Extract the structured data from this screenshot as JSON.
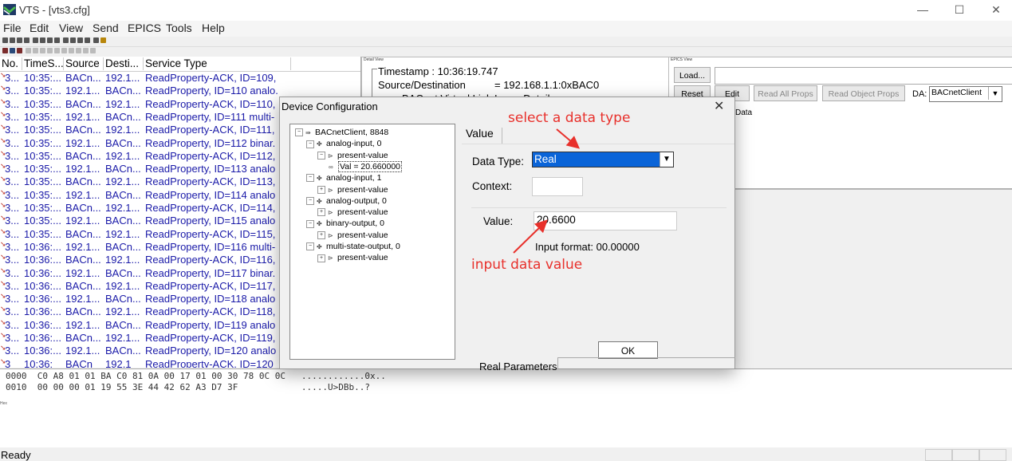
{
  "window": {
    "title": "VTS - [vts3.cfg]",
    "controls": [
      "—",
      "☐",
      "✕"
    ]
  },
  "menu": [
    "File",
    "Edit",
    "View",
    "Send",
    "EPICS",
    "Tools",
    "Help"
  ],
  "list": {
    "headers": [
      "No.",
      "TimeS...",
      "Source",
      "Desti...",
      "Service Type"
    ],
    "rows": [
      {
        "no": "3...",
        "time": "10:35:...",
        "src": "BACn...",
        "dst": "192.1...",
        "svc": "ReadProperty-ACK, ID=109, ..."
      },
      {
        "no": "3...",
        "time": "10:35:...",
        "src": "192.1...",
        "dst": "BACn...",
        "svc": "ReadProperty, ID=110 analo..."
      },
      {
        "no": "3...",
        "time": "10:35:...",
        "src": "BACn...",
        "dst": "192.1...",
        "svc": "ReadProperty-ACK, ID=110,"
      },
      {
        "no": "3...",
        "time": "10:35:...",
        "src": "192.1...",
        "dst": "BACn...",
        "svc": "ReadProperty, ID=111 multi-"
      },
      {
        "no": "3...",
        "time": "10:35:...",
        "src": "BACn...",
        "dst": "192.1...",
        "svc": "ReadProperty-ACK, ID=111,"
      },
      {
        "no": "3...",
        "time": "10:35:...",
        "src": "192.1...",
        "dst": "BACn...",
        "svc": "ReadProperty, ID=112 binar."
      },
      {
        "no": "3...",
        "time": "10:35:...",
        "src": "BACn...",
        "dst": "192.1...",
        "svc": "ReadProperty-ACK, ID=112,"
      },
      {
        "no": "3...",
        "time": "10:35:...",
        "src": "192.1...",
        "dst": "BACn...",
        "svc": "ReadProperty, ID=113 analo"
      },
      {
        "no": "3...",
        "time": "10:35:...",
        "src": "BACn...",
        "dst": "192.1...",
        "svc": "ReadProperty-ACK, ID=113,"
      },
      {
        "no": "3...",
        "time": "10:35:...",
        "src": "192.1...",
        "dst": "BACn...",
        "svc": "ReadProperty, ID=114 analo"
      },
      {
        "no": "3...",
        "time": "10:35:...",
        "src": "BACn...",
        "dst": "192.1...",
        "svc": "ReadProperty-ACK, ID=114,"
      },
      {
        "no": "3...",
        "time": "10:35:...",
        "src": "192.1...",
        "dst": "BACn...",
        "svc": "ReadProperty, ID=115 analo"
      },
      {
        "no": "3...",
        "time": "10:35:...",
        "src": "BACn...",
        "dst": "192.1...",
        "svc": "ReadProperty-ACK, ID=115,"
      },
      {
        "no": "3...",
        "time": "10:36:...",
        "src": "192.1...",
        "dst": "BACn...",
        "svc": "ReadProperty, ID=116 multi-"
      },
      {
        "no": "3...",
        "time": "10:36:...",
        "src": "BACn...",
        "dst": "192.1...",
        "svc": "ReadProperty-ACK, ID=116,"
      },
      {
        "no": "3...",
        "time": "10:36:...",
        "src": "192.1...",
        "dst": "BACn...",
        "svc": "ReadProperty, ID=117 binar."
      },
      {
        "no": "3...",
        "time": "10:36:...",
        "src": "BACn...",
        "dst": "192.1...",
        "svc": "ReadProperty-ACK, ID=117,"
      },
      {
        "no": "3...",
        "time": "10:36:...",
        "src": "192.1...",
        "dst": "BACn...",
        "svc": "ReadProperty, ID=118 analo"
      },
      {
        "no": "3...",
        "time": "10:36:...",
        "src": "BACn...",
        "dst": "192.1...",
        "svc": "ReadProperty-ACK, ID=118,"
      },
      {
        "no": "3...",
        "time": "10:36:...",
        "src": "192.1...",
        "dst": "BACn...",
        "svc": "ReadProperty, ID=119 analo"
      },
      {
        "no": "3...",
        "time": "10:36:...",
        "src": "BACn...",
        "dst": "192.1...",
        "svc": "ReadProperty-ACK, ID=119,"
      },
      {
        "no": "3...",
        "time": "10:36:...",
        "src": "192.1...",
        "dst": "BACn...",
        "svc": "ReadProperty, ID=120 analo"
      },
      {
        "no": "3",
        "time": "10:36:",
        "src": "BACn",
        "dst": "192.1",
        "svc": "ReadProperty-ACK, ID=120"
      }
    ]
  },
  "detail": {
    "caption": "Detail View",
    "timestamp": "Timestamp : 10:36:19.747",
    "srcdst_label": "Source/Destination",
    "srcdst_value": "= 192.168.1.1:0xBAC0",
    "bvll": "BACnet Virtual Link Layer Detail"
  },
  "epics": {
    "caption": "EPICS View",
    "load": "Load...",
    "reset": "Reset",
    "edit": "Edit",
    "read_all": "Read All Props",
    "read_obj": "Read Object Props",
    "da_label": "DA:",
    "da_value": "BACnetClient",
    "data_col": "Data"
  },
  "hex": {
    "lines": [
      "0000  C0 A8 01 01 BA C0 81 0A 00 17 01 00 30 78 0C 0C   ............0x..",
      "0010  00 00 00 01 19 55 3E 44 42 62 A3 D7 3F            .....U>DBb..?"
    ],
    "caption": "Hex"
  },
  "status": "Ready",
  "dialog": {
    "title": "Device Configuration",
    "tree": [
      {
        "label": "BACnetClient, 8848",
        "level": 0,
        "icon": "device-icon",
        "expander": "−"
      },
      {
        "label": "analog-input, 0",
        "level": 1,
        "icon": "object-icon",
        "expander": "−"
      },
      {
        "label": "present-value",
        "level": 2,
        "icon": "property-icon",
        "expander": "−"
      },
      {
        "label": "Val = 20.660000",
        "level": 3,
        "icon": "value-icon",
        "expander": "",
        "selected": true
      },
      {
        "label": "analog-input, 1",
        "level": 1,
        "icon": "object-icon",
        "expander": "−"
      },
      {
        "label": "present-value",
        "level": 2,
        "icon": "property-icon",
        "expander": "+"
      },
      {
        "label": "analog-output, 0",
        "level": 1,
        "icon": "object-icon",
        "expander": "−"
      },
      {
        "label": "present-value",
        "level": 2,
        "icon": "property-icon",
        "expander": "+"
      },
      {
        "label": "binary-output, 0",
        "level": 1,
        "icon": "object-icon",
        "expander": "−"
      },
      {
        "label": "present-value",
        "level": 2,
        "icon": "property-icon",
        "expander": "+"
      },
      {
        "label": "multi-state-output, 0",
        "level": 1,
        "icon": "object-icon",
        "expander": "−"
      },
      {
        "label": "present-value",
        "level": 2,
        "icon": "property-icon",
        "expander": "+"
      }
    ],
    "tab": "Value",
    "data_type_label": "Data Type:",
    "data_type_value": "Real",
    "context_label": "Context:",
    "value_label": "Value:",
    "value": "20.6600",
    "input_format": "Input format:  00.00000",
    "ok": "OK",
    "real_params": "Real Parameters"
  },
  "annotations": {
    "select": "select a data type",
    "input": "input data value",
    "color": "#e8302b"
  }
}
